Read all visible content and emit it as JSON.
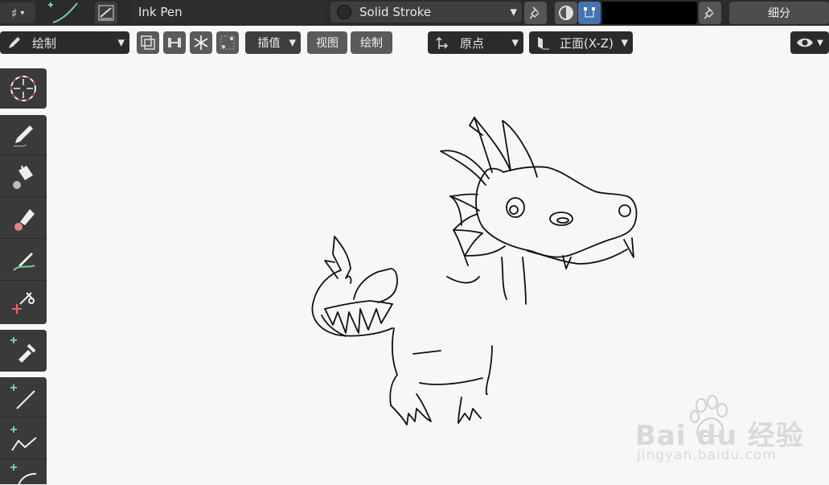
{
  "header": {
    "brush_name": "Ink Pen",
    "material_name": "Solid Stroke",
    "subdivide_label": "细分"
  },
  "toolbar": {
    "mode_label": "绘制",
    "interpolate_label": "插值",
    "view_label": "视图",
    "draw_label": "绘制",
    "origin_label": "原点",
    "orientation_label": "正面(X-Z)"
  },
  "watermark": {
    "brand": "Bai  du 经验",
    "url": "jingyan.baidu.com"
  },
  "colors": {
    "accent": "#4772b3",
    "topbar": "#2b2b2b",
    "canvas": "#f7f7f7",
    "tool_panel": "#3a3a3a",
    "green_plus": "#6fd39a"
  }
}
